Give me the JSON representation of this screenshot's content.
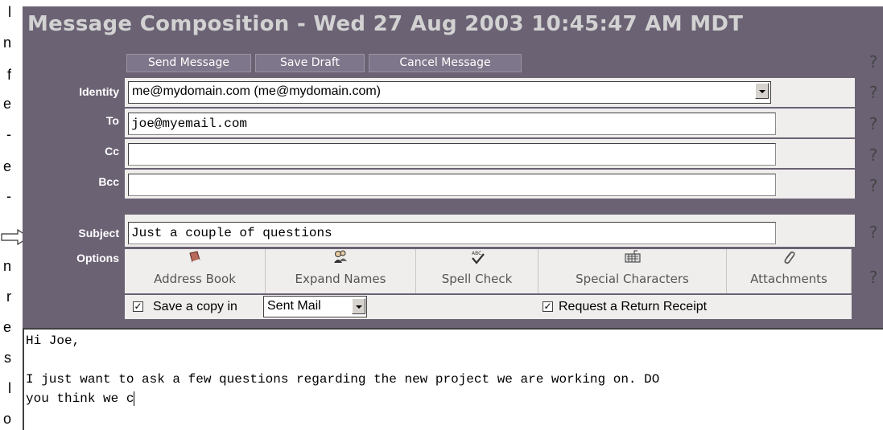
{
  "margin_text": [
    "l",
    "n",
    "f",
    "e",
    "-",
    "e",
    "-",
    "n",
    "r",
    "e",
    "s",
    "l",
    "o"
  ],
  "window": {
    "title": "Message Composition - Wed 27 Aug 2003 10:45:47 AM MDT"
  },
  "toolbar": {
    "send_label": "Send Message",
    "save_label": "Save Draft",
    "cancel_label": "Cancel Message",
    "help": "?"
  },
  "fields": {
    "identity": {
      "label": "Identity",
      "value": "me@mydomain.com (me@mydomain.com)"
    },
    "to": {
      "label": "To",
      "value": "joe@myemail.com"
    },
    "cc": {
      "label": "Cc",
      "value": ""
    },
    "bcc": {
      "label": "Bcc",
      "value": ""
    },
    "subject": {
      "label": "Subject",
      "value": "Just a couple of questions"
    }
  },
  "options": {
    "label": "Options",
    "buttons": [
      {
        "label": "Address Book",
        "icon": "book-icon"
      },
      {
        "label": "Expand Names",
        "icon": "people-icon"
      },
      {
        "label": "Spell Check",
        "icon": "spellcheck-icon"
      },
      {
        "label": "Special Characters",
        "icon": "keyboard-icon"
      },
      {
        "label": "Attachments",
        "icon": "paperclip-icon"
      }
    ],
    "save_copy_label": "Save a copy in",
    "save_copy_checked": true,
    "save_copy_folder": "Sent Mail",
    "return_receipt_label": "Request a Return Receipt",
    "return_receipt_checked": true
  },
  "message_body": {
    "lines": [
      "Hi Joe,",
      "",
      "I just want to ask a few questions regarding the new project we are working on. DO",
      "you think we c"
    ]
  },
  "colors": {
    "window_bg": "#6b6274",
    "button_bg": "#7e768a",
    "row_bg": "#efeeec",
    "title_text": "#d2d2d2"
  }
}
